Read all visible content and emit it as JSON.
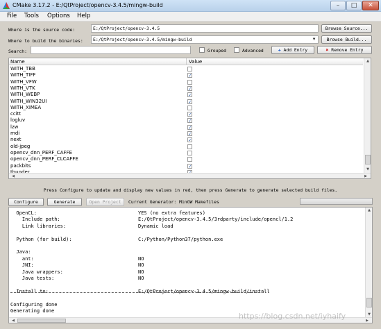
{
  "window": {
    "title": "CMake 3.17.2 - E:/QtProject/opencv-3.4.5/mingw-build",
    "minimize": "–",
    "maximize": "□",
    "close": "✕"
  },
  "menu": [
    "File",
    "Tools",
    "Options",
    "Help"
  ],
  "source": {
    "label": "Where is the source code:",
    "value": "E:/QtProject/opencv-3.4.5",
    "button": "Browse Source..."
  },
  "build": {
    "label": "Where to build the binaries:",
    "value": "E:/QtProject/opencv-3.4.5/mingw-build",
    "button": "Browse Build..."
  },
  "search": {
    "label": "Search:",
    "value": ""
  },
  "options": {
    "grouped": "Grouped",
    "advanced": "Advanced",
    "add_entry": "Add Entry",
    "remove_entry": "Remove Entry"
  },
  "table": {
    "headers": [
      "Name",
      "Value"
    ],
    "rows": [
      {
        "name": "WITH_TBB",
        "checked": false
      },
      {
        "name": "WITH_TIFF",
        "checked": true
      },
      {
        "name": "WITH_VFW",
        "checked": false
      },
      {
        "name": "WITH_VTK",
        "checked": true
      },
      {
        "name": "WITH_WEBP",
        "checked": true
      },
      {
        "name": "WITH_WIN32UI",
        "checked": true
      },
      {
        "name": "WITH_XIMEA",
        "checked": false
      },
      {
        "name": "ccitt",
        "checked": true
      },
      {
        "name": "logluv",
        "checked": true
      },
      {
        "name": "lzw",
        "checked": true
      },
      {
        "name": "mdi",
        "checked": true
      },
      {
        "name": "next",
        "checked": true
      },
      {
        "name": "old-jpeg",
        "checked": false
      },
      {
        "name": "opencv_dnn_PERF_CAFFE",
        "checked": false
      },
      {
        "name": "opencv_dnn_PERF_CLCAFFE",
        "checked": false
      },
      {
        "name": "packbits",
        "checked": true
      },
      {
        "name": "thunder",
        "checked": true
      }
    ]
  },
  "info_text": "Press Configure to update and display new values in red, then press Generate to generate selected build files.",
  "actions": {
    "configure": "Configure",
    "generate": "Generate",
    "open_project": "Open Project",
    "generator": "Current Generator: MinGW Makefiles"
  },
  "output": {
    "lines": [
      {
        "k": "  OpenCL:",
        "v": "YES (no extra features)"
      },
      {
        "k": "    Include path:",
        "v": "E:/QtProject/opencv-3.4.5/3rdparty/include/opencl/1.2"
      },
      {
        "k": "    Link libraries:",
        "v": "Dynamic load"
      },
      {
        "k": "",
        "v": ""
      },
      {
        "k": "  Python (for build):",
        "v": "C:/Python/Python37/python.exe"
      },
      {
        "k": "",
        "v": ""
      },
      {
        "k": "  Java:",
        "v": ""
      },
      {
        "k": "    ant:",
        "v": "NO"
      },
      {
        "k": "    JNI:",
        "v": "NO"
      },
      {
        "k": "    Java wrappers:",
        "v": "NO"
      },
      {
        "k": "    Java tests:",
        "v": "NO"
      },
      {
        "k": "",
        "v": ""
      },
      {
        "k": "  Install to:",
        "v": "E:/QtProject/opencv-3.4.5/mingw-build/install"
      }
    ],
    "footer": [
      "Configuring done",
      "Generating done"
    ]
  },
  "watermark": "https://blog.csdn.net/iyhaify",
  "colors": {
    "title_bg": "#c4daf1",
    "remove_icon": "#cc2222",
    "add_icon": "#2a66cc",
    "check": "#2a5ba8"
  }
}
